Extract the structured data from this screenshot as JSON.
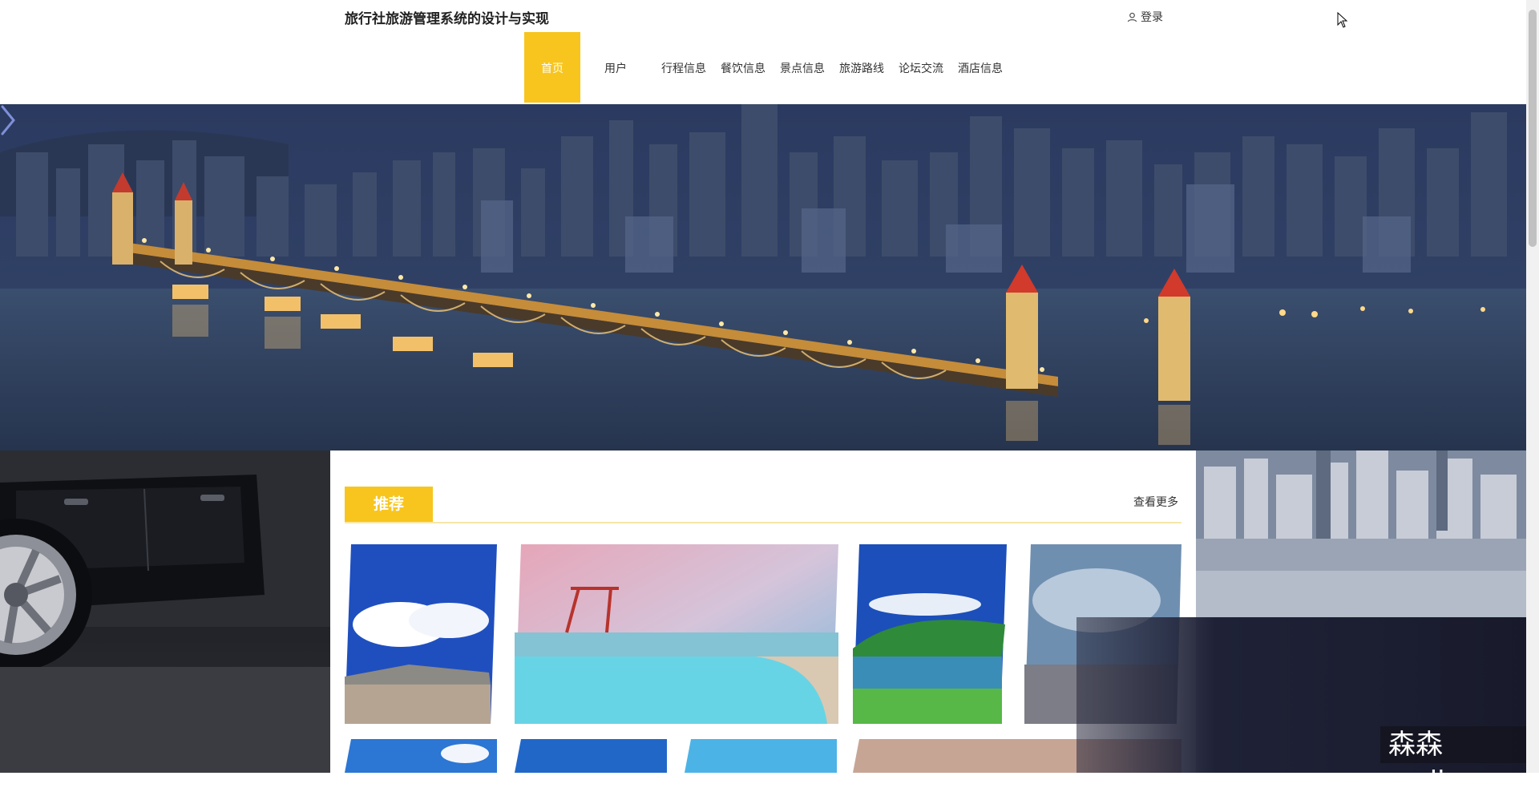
{
  "header": {
    "site_title": "旅行社旅游管理系统的设计与实现",
    "login_label": "登录"
  },
  "nav": {
    "items": [
      {
        "label": "首页",
        "active": true
      },
      {
        "label": "用户"
      },
      {
        "label": "行程信息"
      },
      {
        "label": "餐饮信息"
      },
      {
        "label": "景点信息"
      },
      {
        "label": "旅游路线"
      },
      {
        "label": "论坛交流"
      },
      {
        "label": "酒店信息"
      }
    ]
  },
  "recommend": {
    "title": "推荐",
    "more_label": "查看更多"
  },
  "watermark": "森森coding",
  "colors": {
    "accent": "#f7c51e",
    "accent_line": "#f7e7a8"
  }
}
